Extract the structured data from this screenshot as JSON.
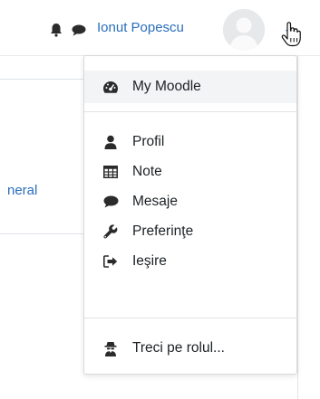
{
  "navbar": {
    "user_name": "Ionut Popescu",
    "icons": [
      "bell-icon",
      "chat-icon",
      "avatar",
      "caret-down-icon",
      "hand-cursor-icon"
    ]
  },
  "background": {
    "link_fragment": "neral"
  },
  "user_menu": {
    "items": [
      {
        "label": "My Moodle",
        "icon": "dashboard-icon",
        "active": true
      },
      {
        "label": "Profil",
        "icon": "user-icon"
      },
      {
        "label": "Note",
        "icon": "table-icon"
      },
      {
        "label": "Mesaje",
        "icon": "chat-icon"
      },
      {
        "label": "Preferinţe",
        "icon": "wrench-icon"
      },
      {
        "label": "Ieşire",
        "icon": "sign-out-icon"
      },
      {
        "label": "Treci pe rolul...",
        "icon": "user-secret-icon"
      }
    ]
  },
  "colors": {
    "link": "#2a6ebb",
    "icon": "#2b2b2b",
    "hover_bg": "#f2f4f6"
  }
}
